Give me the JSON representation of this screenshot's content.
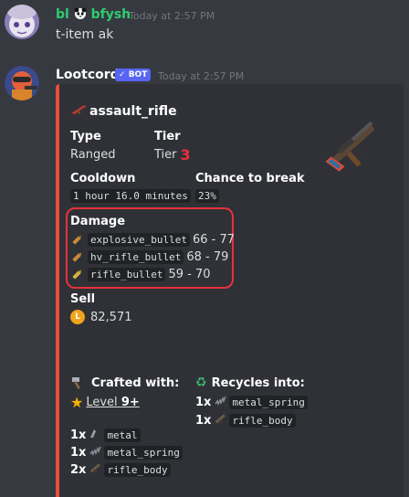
{
  "message1": {
    "username": "bl",
    "username2": "bfysh",
    "timestamp": "Today at 2:57 PM",
    "content": "t-item ak"
  },
  "message2": {
    "username": "Lootcord",
    "bot_tag": "BOT",
    "timestamp": "Today at 2:57 PM"
  },
  "embed": {
    "title": "assault_rifle",
    "accent_color": "#e74c3c",
    "type_label": "Type",
    "type_value": "Ranged",
    "tier_label": "Tier",
    "tier_text": "Tier",
    "tier_number": "3",
    "cooldown_label": "Cooldown",
    "cooldown_value": "1 hour 16.0 minutes",
    "break_label": "Chance to break",
    "break_value": "23%",
    "damage_label": "Damage",
    "damage": [
      {
        "ammo": "explosive_bullet",
        "range": "66 - 77"
      },
      {
        "ammo": "hv_rifle_bullet",
        "range": "68 - 79"
      },
      {
        "ammo": "rifle_bullet",
        "range": "59 - 70"
      }
    ],
    "sell_label": "Sell",
    "sell_value": "82,571",
    "crafted_label": "Crafted with:",
    "level_text": "Level",
    "level_number": "9+",
    "craft_items": [
      {
        "qty": "1x",
        "name": "metal"
      },
      {
        "qty": "1x",
        "name": "metal_spring"
      },
      {
        "qty": "2x",
        "name": "rifle_body"
      }
    ],
    "recycles_label": "Recycles into:",
    "recycle_items": [
      {
        "qty": "1x",
        "name": "metal_spring"
      },
      {
        "qty": "1x",
        "name": "rifle_body"
      }
    ]
  }
}
